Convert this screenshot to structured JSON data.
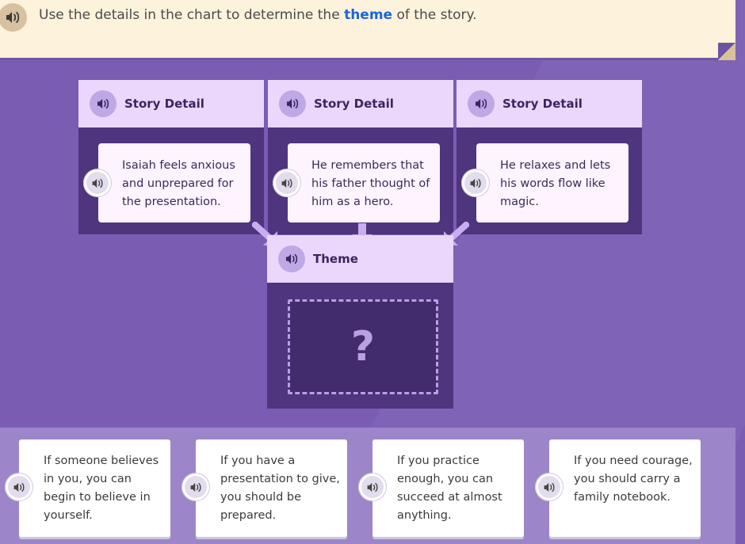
{
  "instruction": {
    "before": "Use the details in the chart to determine the ",
    "keyword": "theme",
    "after": " of the story."
  },
  "details": [
    {
      "heading": "Story Detail",
      "text": "Isaiah feels anxious and unprepared for the presentation."
    },
    {
      "heading": "Story Detail",
      "text": "He remembers that his father thought of him as a hero."
    },
    {
      "heading": "Story Detail",
      "text": "He relaxes and lets his words flow like magic."
    }
  ],
  "theme": {
    "heading": "Theme",
    "placeholder": "?"
  },
  "choices": [
    {
      "text": "If someone believes in you, you can begin to believe in yourself."
    },
    {
      "text": "If you have a presentation to give, you should be prepared."
    },
    {
      "text": "If you practice enough, you can succeed at almost anything."
    },
    {
      "text": "If you need courage, you should carry a family notebook."
    }
  ],
  "colors": {
    "keyword": "#1a66d9",
    "background": "#7a5db3",
    "header_fill": "#ebd7fb",
    "column_fill": "#4f347e"
  },
  "icons": [
    "speaker-icon"
  ]
}
